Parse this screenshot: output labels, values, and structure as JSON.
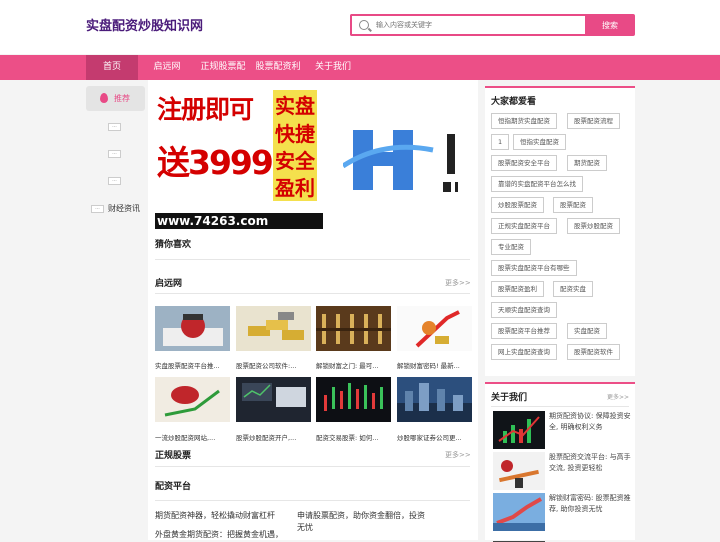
{
  "header": {
    "logo": "实盘配资炒股知识网",
    "search_placeholder": "输入内容或关键字",
    "search_button": "搜索"
  },
  "nav": {
    "items": [
      "首页",
      "启远网",
      "正规股票配",
      "股票配资利",
      "关于我们"
    ]
  },
  "sidebar": {
    "recommend": "推荐",
    "dash": "···",
    "finance": "财经资讯"
  },
  "banner": {
    "row1a": "注册即可",
    "row1b": "实盘",
    "row2a": "送3999",
    "row2b": "快捷",
    "row3": "安全",
    "row4": "盈利",
    "url": "www.74263.com"
  },
  "main": {
    "guess": "猜你喜欢",
    "sec1_title": "启远网",
    "more": "更多>>",
    "thumbs": [
      "实盘股票配资平台推...",
      "股票配资公司软件:...",
      "解锁财富之门: 最可...",
      "解锁财富密码! 最新...",
      "一流炒股配资网站,...",
      "股票炒股配资开户,...",
      "配资交易股票: 如何...",
      "炒股哪家证券公司更..."
    ],
    "sec2_title": "正规股票",
    "sec3_title": "配资平台",
    "links": [
      "期货配资神器，轻松撬动财富杠杆",
      "申请股票配资，助你资金翻倍，投资",
      "无忧",
      "外盘黄金期货配资：把握黄金机遇，"
    ]
  },
  "right": {
    "title": "大家都爱看",
    "tags": [
      "恒指期货实盘配资",
      "股票配资流程",
      "1",
      "恒指实盘配资",
      "股票配资安全平台",
      "期货配资",
      "靠谱的实盘配资平台怎么找",
      "炒股股票配资",
      "股票配资",
      "正规实盘配资平台",
      "股票炒股配资",
      "专业配资",
      "股票实盘配资平台有哪些",
      "股票配资盈利",
      "配资实盘",
      "天顺实盘配资查询",
      "股票配资平台推荐",
      "实盘配资",
      "网上实盘配资查询",
      "股票配资软件"
    ]
  },
  "about": {
    "title": "关于我们",
    "more": "更多>>",
    "items": [
      "期货配资协议: 保障投资安全, 明确权利义务",
      "股票配资交流平台: 与高手交流, 投资更轻松",
      "解锁财富密码: 股票配资推荐, 助你投资无忧"
    ]
  },
  "colors": {
    "accent": "#ec4f87",
    "nav_active": "#c43b6f",
    "logo": "#4a1b7a"
  }
}
